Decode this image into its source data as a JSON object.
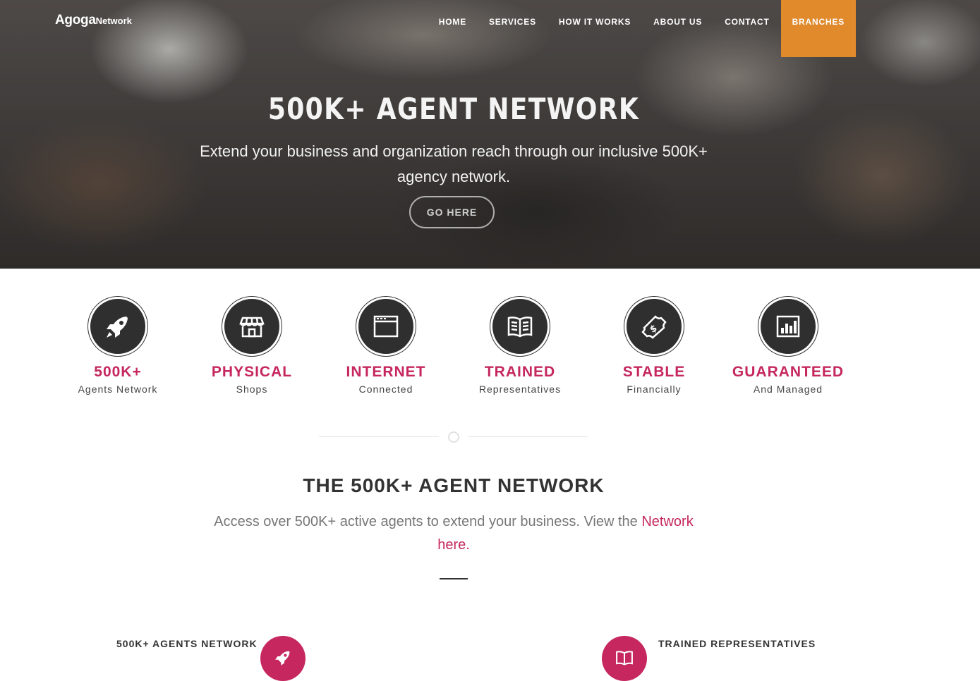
{
  "brand": {
    "name_main": "Agoga",
    "name_sub": "Network"
  },
  "nav": {
    "items": [
      {
        "label": "HOME"
      },
      {
        "label": "SERVICES"
      },
      {
        "label": "HOW IT WORKS"
      },
      {
        "label": "ABOUT US"
      },
      {
        "label": "CONTACT"
      },
      {
        "label": "BRANCHES"
      }
    ],
    "active_color": "#e08a2c"
  },
  "hero": {
    "title": "500K+ AGENT NETWORK",
    "subtitle": "Extend your business and organization reach through our inclusive 500K+ agency network.",
    "button_label": "GO HERE"
  },
  "features": [
    {
      "icon": "rocket-icon",
      "title": "500K+",
      "subtitle": "Agents Network"
    },
    {
      "icon": "shop-icon",
      "title": "PHYSICAL",
      "subtitle": "Shops"
    },
    {
      "icon": "browser-window-icon",
      "title": "INTERNET",
      "subtitle": "Connected"
    },
    {
      "icon": "open-book-icon",
      "title": "TRAINED",
      "subtitle": "Representatives"
    },
    {
      "icon": "money-icon",
      "title": "STABLE",
      "subtitle": "Financially"
    },
    {
      "icon": "bar-chart-icon",
      "title": "GUARANTEED",
      "subtitle": "And Managed"
    }
  ],
  "section": {
    "title": "THE 500K+ AGENT NETWORK",
    "text_before": "Access over 500K+ active agents to extend your business. View the ",
    "link_text": "Network here",
    "text_after": "."
  },
  "bottom_items": [
    {
      "title": "500K+ AGENTS NETWORK",
      "icon": "rocket-icon"
    },
    {
      "title": "TRAINED REPRESENTATIVES",
      "icon": "open-book-icon"
    }
  ],
  "colors": {
    "accent_pink": "#c5275e",
    "accent_orange": "#e08a2c",
    "icon_dark": "#2f2f2f"
  }
}
